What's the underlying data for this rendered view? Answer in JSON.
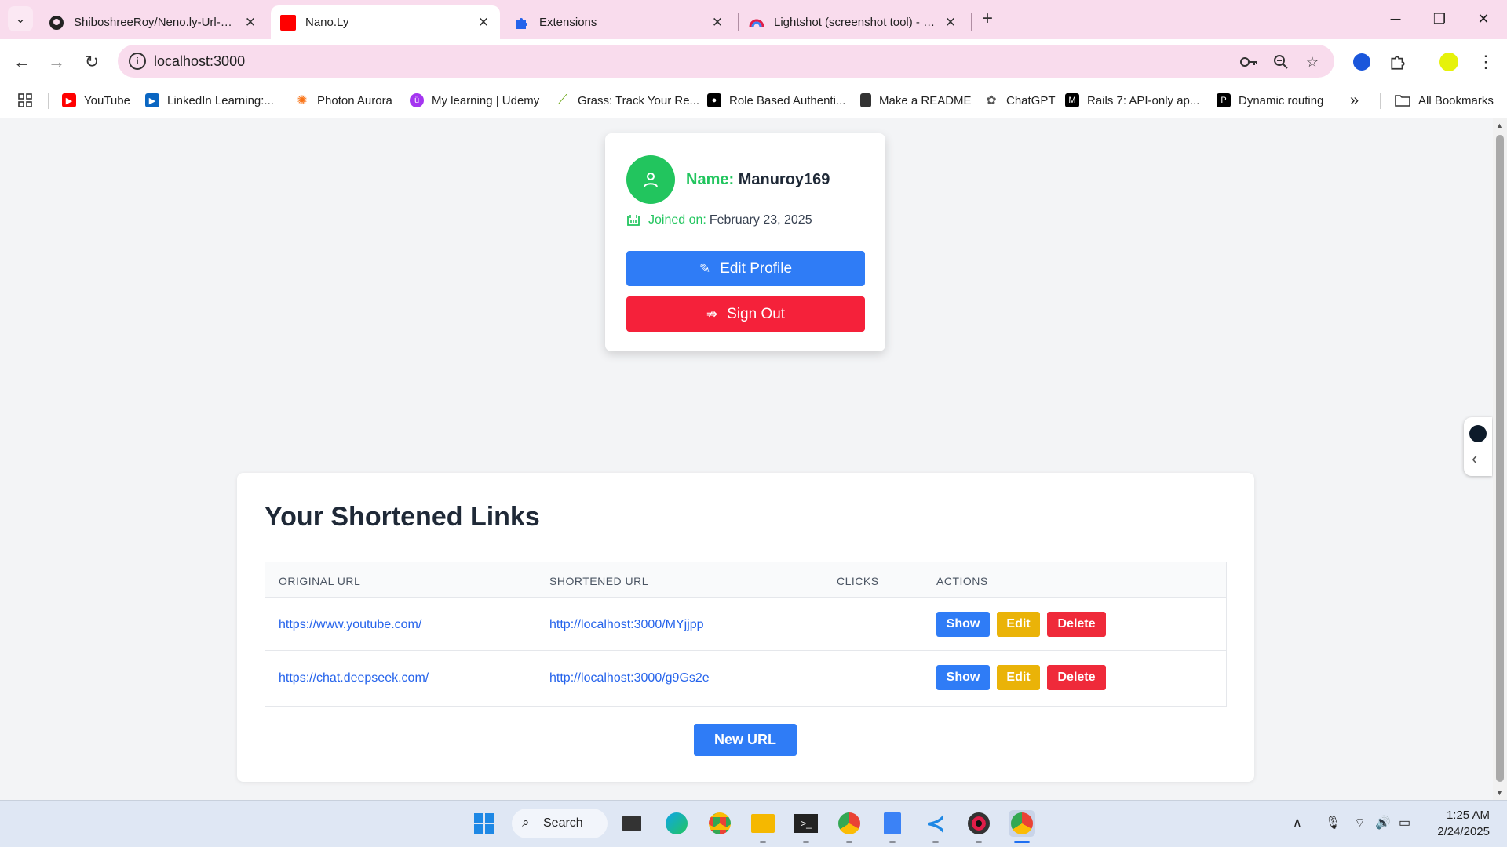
{
  "browser": {
    "tabs": [
      {
        "title": "ShiboshreeRoy/Neno.ly-Url-Sho",
        "icon": "github-icon",
        "active": false
      },
      {
        "title": "Nano.Ly",
        "icon": "red-square-favicon",
        "active": true
      },
      {
        "title": "Extensions",
        "icon": "puzzle-icon",
        "active": false
      },
      {
        "title": "Lightshot (screenshot tool) - Ch",
        "icon": "rainbow-icon",
        "active": false
      }
    ],
    "address": "localhost:3000",
    "bookmarks": [
      {
        "label": "YouTube",
        "color": "#ff0000"
      },
      {
        "label": "LinkedIn Learning:...",
        "color": "#0a66c2"
      },
      {
        "label": "Photon Aurora",
        "color": "#f97316"
      },
      {
        "label": "My learning | Udemy",
        "color": "#a435f0"
      },
      {
        "label": "Grass: Track Your Re...",
        "color": "#65a30d"
      },
      {
        "label": "Role Based Authenti...",
        "color": "#000000"
      },
      {
        "label": "Make a README",
        "color": "#333333"
      },
      {
        "label": "ChatGPT",
        "color": "#555555"
      },
      {
        "label": "Rails 7: API-only ap...",
        "color": "#000000"
      },
      {
        "label": "Dynamic routing",
        "color": "#000000"
      }
    ],
    "bookmarks_more": "»",
    "all_bookmarks": "All Bookmarks"
  },
  "profile": {
    "name_label": "Name:",
    "name": "Manuroy169",
    "joined_label": "Joined on:",
    "joined_date": "February 23, 2025",
    "edit_button": "Edit Profile",
    "signout_button": "Sign Out"
  },
  "links": {
    "title": "Your Shortened Links",
    "headers": [
      "ORIGINAL URL",
      "SHORTENED URL",
      "CLICKS",
      "ACTIONS"
    ],
    "rows": [
      {
        "original": "https://www.youtube.com/",
        "short": "http://localhost:3000/MYjjpp",
        "clicks": ""
      },
      {
        "original": "https://chat.deepseek.com/",
        "short": "http://localhost:3000/g9Gs2e",
        "clicks": ""
      }
    ],
    "actions": {
      "show": "Show",
      "edit": "Edit",
      "delete": "Delete"
    },
    "new_url_button": "New URL"
  },
  "taskbar": {
    "search_label": "Search",
    "time": "1:25 AM",
    "date": "2/24/2025"
  },
  "colors": {
    "accent_green": "#22c55e",
    "primary_blue": "#2f7cf6",
    "danger_red": "#f5213a",
    "warning_yellow": "#eab308",
    "tab_strip_pink": "#f9dced"
  }
}
